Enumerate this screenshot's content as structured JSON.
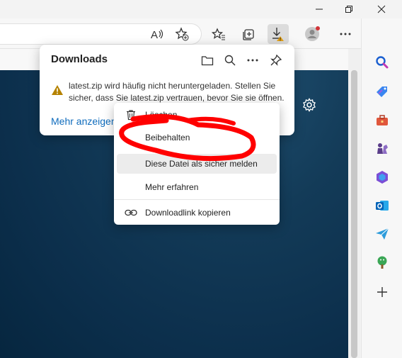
{
  "toolbar": {
    "read_aloud_icon": "read-aloud-icon",
    "favorite_icon": "add-favorite-icon",
    "favorites_icon": "favorites-icon",
    "collections_icon": "collections-icon",
    "downloads_icon": "downloads-icon",
    "profile_icon": "profile-icon",
    "more_icon": "more-icon",
    "copilot_icon": "bing-icon"
  },
  "downloads_panel": {
    "title": "Downloads",
    "message": "latest.zip wird häufig nicht heruntergeladen. Stellen Sie sicher, dass Sie latest.zip vertrauen, bevor Sie sie öffnen.",
    "show_more": "Mehr anzeigen"
  },
  "context_menu": {
    "items": [
      {
        "label": "Löschen",
        "icon": "trash-icon"
      },
      {
        "label": "Beibehalten",
        "icon": ""
      },
      {
        "label": "Diese Datei als sicher melden",
        "icon": ""
      },
      {
        "label": "Mehr erfahren",
        "icon": ""
      },
      {
        "label": "Downloadlink kopieren",
        "icon": "link-icon"
      }
    ]
  },
  "colors": {
    "accent": "#0f6cbd",
    "warning": "#b8860b",
    "annotation": "#ff0000"
  }
}
